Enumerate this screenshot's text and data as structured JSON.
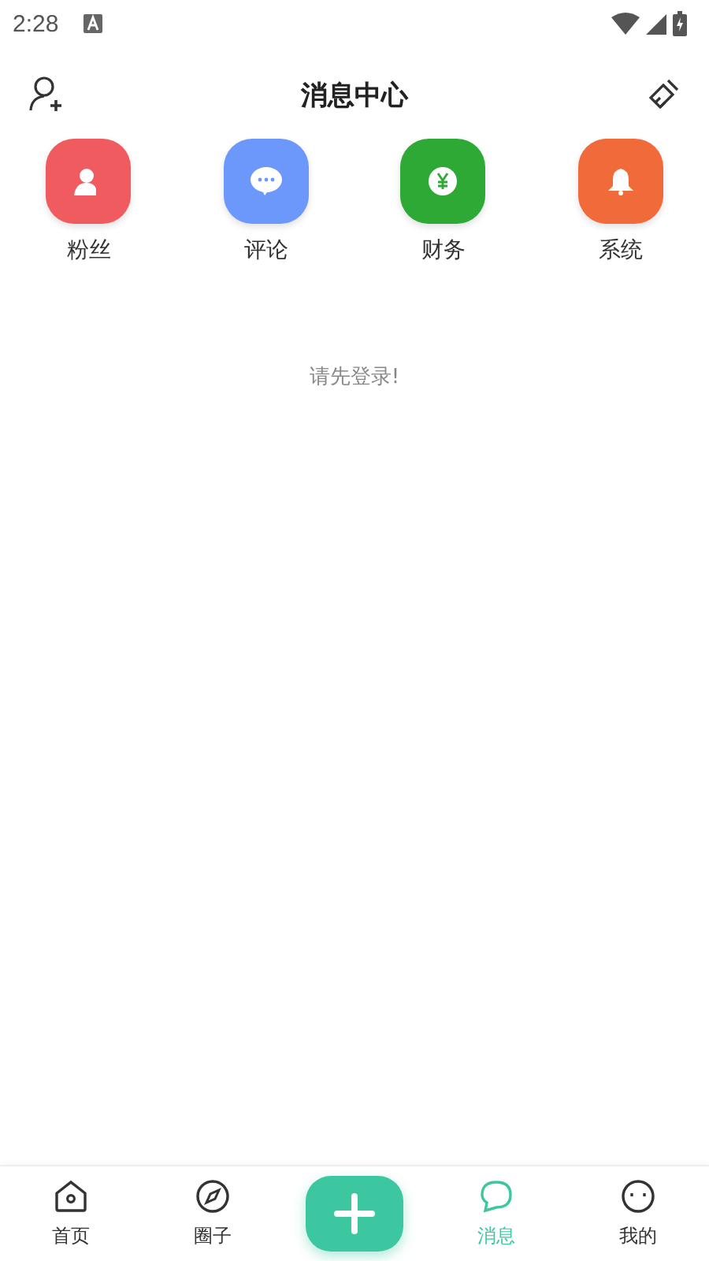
{
  "status_bar": {
    "time": "2:28"
  },
  "header": {
    "title": "消息中心"
  },
  "categories": [
    {
      "label": "粉丝",
      "color": "#ef5b5e"
    },
    {
      "label": "评论",
      "color": "#6b98fa"
    },
    {
      "label": "财务",
      "color": "#2ea935"
    },
    {
      "label": "系统",
      "color": "#f06a3a"
    }
  ],
  "empty_message": "请先登录!",
  "tab_bar": [
    {
      "kind": "tab",
      "label": "首页",
      "selected": false
    },
    {
      "kind": "tab",
      "label": "圈子",
      "selected": false
    },
    {
      "kind": "add"
    },
    {
      "kind": "tab",
      "label": "消息",
      "selected": true
    },
    {
      "kind": "tab",
      "label": "我的",
      "selected": false
    }
  ]
}
